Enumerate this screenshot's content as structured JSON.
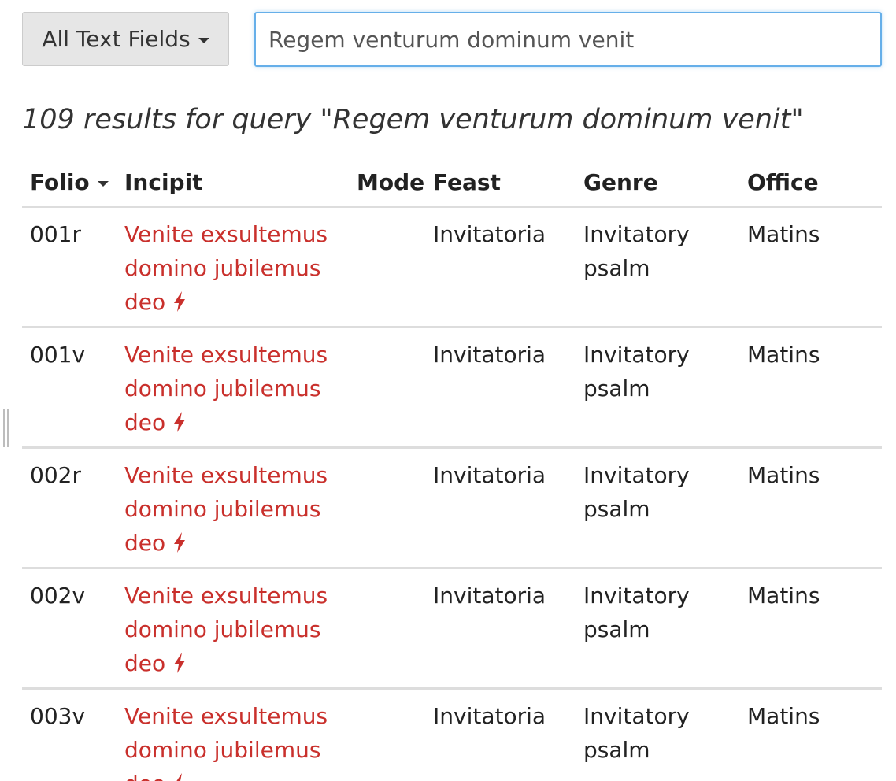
{
  "search": {
    "field_selector_label": "All Text Fields",
    "query_value": "Regem venturum dominum venit"
  },
  "results": {
    "summary": "109 results for query \"Regem venturum dominum venit\""
  },
  "table": {
    "headers": {
      "folio": "Folio",
      "incipit": "Incipit",
      "mode": "Mode",
      "feast": "Feast",
      "genre": "Genre",
      "office": "Office"
    },
    "rows": [
      {
        "folio": "001r",
        "incipit": "Venite exsultemus domino jubilemus deo",
        "mode": "",
        "feast": "Invitatoria",
        "genre": "Invitatory psalm",
        "office": "Matins"
      },
      {
        "folio": "001v",
        "incipit": "Venite exsultemus domino jubilemus deo",
        "mode": "",
        "feast": "Invitatoria",
        "genre": "Invitatory psalm",
        "office": "Matins"
      },
      {
        "folio": "002r",
        "incipit": "Venite exsultemus domino jubilemus deo",
        "mode": "",
        "feast": "Invitatoria",
        "genre": "Invitatory psalm",
        "office": "Matins"
      },
      {
        "folio": "002v",
        "incipit": "Venite exsultemus domino jubilemus deo",
        "mode": "",
        "feast": "Invitatoria",
        "genre": "Invitatory psalm",
        "office": "Matins"
      },
      {
        "folio": "003v",
        "incipit": "Venite exsultemus domino jubilemus deo",
        "mode": "",
        "feast": "Invitatoria",
        "genre": "Invitatory psalm",
        "office": "Matins"
      }
    ]
  },
  "colors": {
    "link": "#c9302c",
    "focus_border": "#66afe9",
    "row_border": "#dddddd"
  },
  "icons": {
    "dropdown": "caret-down-icon",
    "sort": "sort-caret-icon",
    "incipit_action": "bolt-icon"
  }
}
